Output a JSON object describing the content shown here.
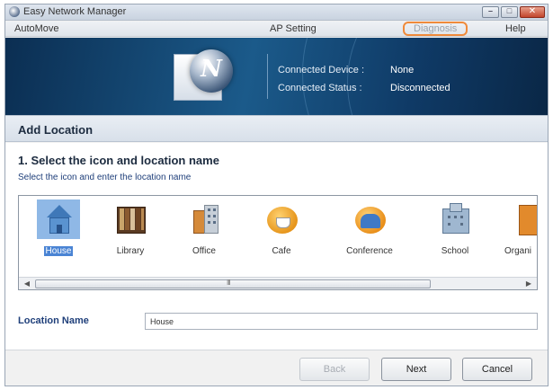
{
  "window": {
    "title": "Easy Network Manager"
  },
  "menu": {
    "items": [
      "AutoMove",
      "AP Setting",
      "Diagnosis",
      "Help"
    ]
  },
  "banner": {
    "logo_letter": "N",
    "device_label": "Connected Device :",
    "device_value": "None",
    "status_label": "Connected Status :",
    "status_value": "Disconnected"
  },
  "section": {
    "title": "Add Location"
  },
  "step": {
    "title": "1. Select the icon and location name",
    "subtitle": "Select the icon and enter the location name"
  },
  "locations": [
    {
      "label": "House",
      "icon": "house-icon",
      "selected": true
    },
    {
      "label": "Library",
      "icon": "library-icon",
      "selected": false
    },
    {
      "label": "Office",
      "icon": "office-icon",
      "selected": false
    },
    {
      "label": "Cafe",
      "icon": "cafe-icon",
      "selected": false
    },
    {
      "label": "Conference",
      "icon": "conference-icon",
      "selected": false
    },
    {
      "label": "School",
      "icon": "school-icon",
      "selected": false
    },
    {
      "label": "Organi",
      "icon": "organization-icon",
      "selected": false
    }
  ],
  "scrollbar": {
    "grip": "III"
  },
  "location_name": {
    "label": "Location Name",
    "value": "House"
  },
  "buttons": {
    "back": "Back",
    "next": "Next",
    "cancel": "Cancel"
  }
}
